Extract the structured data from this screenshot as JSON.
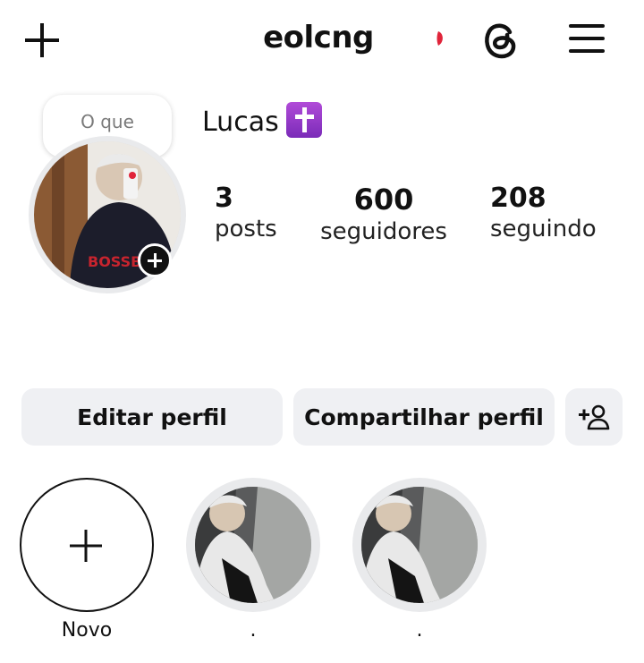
{
  "header": {
    "username": "eolcng",
    "icons": [
      "plus-icon",
      "notification-dot",
      "threads-icon",
      "menu-icon"
    ]
  },
  "profile": {
    "note": "O que",
    "name": "Lucas",
    "badge_icon": "latin-cross-emoji",
    "stats": [
      {
        "value": "3",
        "label": "posts"
      },
      {
        "value": "600",
        "label": "seguidores"
      },
      {
        "value": "208",
        "label": "seguindo"
      }
    ]
  },
  "actions": {
    "edit_label": "Editar perfil",
    "share_label": "Compartilhar perfil",
    "add_user_icon": "add-person-icon"
  },
  "highlights": [
    {
      "label": "Novo"
    },
    {
      "label": "."
    },
    {
      "label": "."
    }
  ],
  "colors": {
    "button_bg": "#eff0f3",
    "ring": "#e9eaec",
    "note_text": "#7a7a7a",
    "dot": "#e0243a"
  }
}
